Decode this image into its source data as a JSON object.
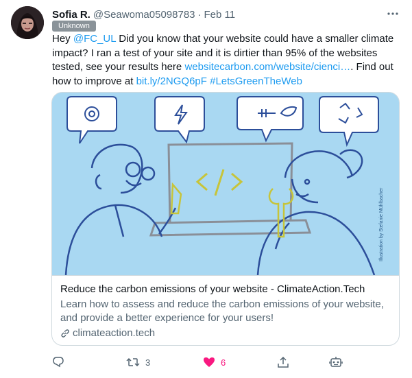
{
  "tweet": {
    "author_name": "Sofia R.",
    "handle": "@Seawoma05098783",
    "separator": "·",
    "date": "Feb 11",
    "badge": "Unknown",
    "text": {
      "p1": "Hey ",
      "mention": "@FC_UL",
      "p2": " Did you know that your website could have a smaller climate impact? I ran a test of your site and it is dirtier than 95% of the websites tested, see your results here ",
      "link1": "websitecarbon.com/website/cienci…",
      "p3": ". Find out how to improve at ",
      "link2": "bit.ly/2NGQ6pF",
      "p4": " ",
      "hashtag": "#LetsGreenTheWeb"
    }
  },
  "card": {
    "illustration_credit": "Illustration by Stefanie Mühlbacher",
    "title": "Reduce the carbon emissions of your website - ClimateAction.Tech",
    "description": "Learn how to assess and reduce the carbon emissions of your website, and provide a better experience for your users!",
    "domain": "climateaction.tech",
    "code_glyph": "</>"
  },
  "actions": {
    "replies": "",
    "retweets": "3",
    "likes": "6",
    "share": ""
  },
  "colors": {
    "link": "#1d9bf0",
    "like": "#f91880",
    "muted": "#536471",
    "illustration_bg": "#a9d8f2"
  },
  "icons": [
    "more-icon",
    "link-icon",
    "reply-icon",
    "retweet-icon",
    "like-icon",
    "share-icon",
    "bot-icon"
  ]
}
